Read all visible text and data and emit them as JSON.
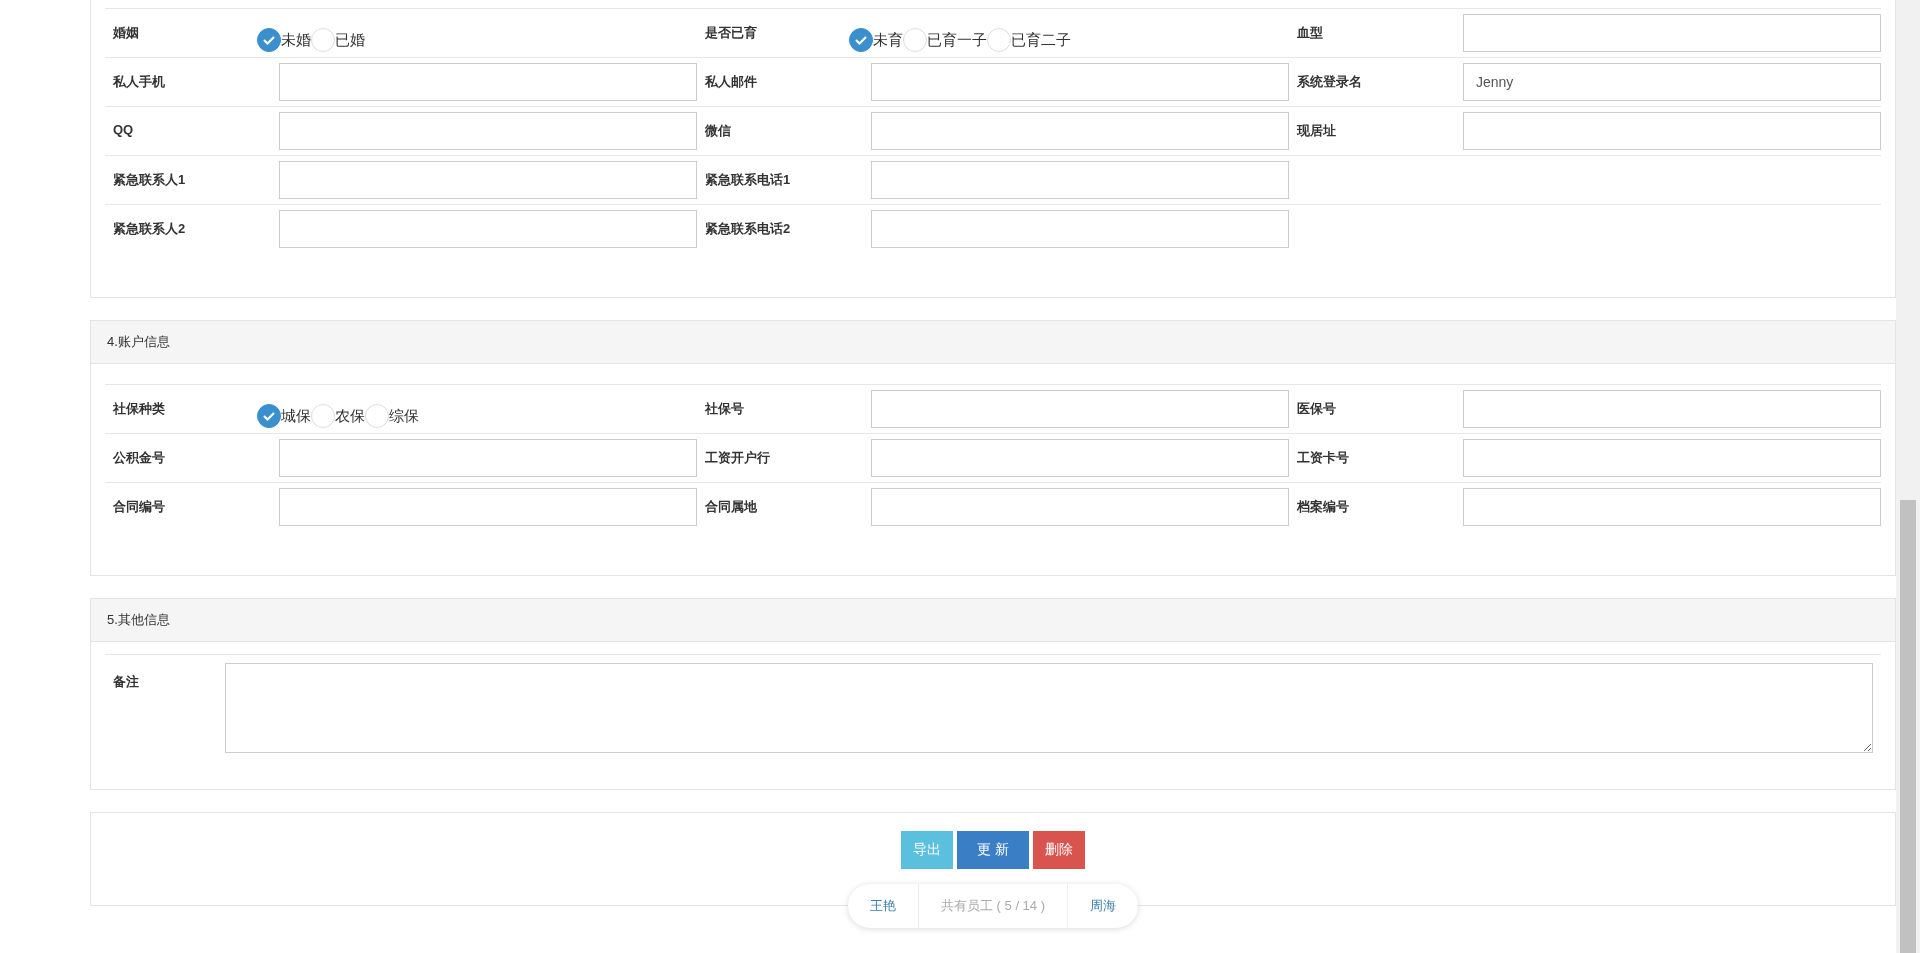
{
  "sections": [
    {
      "rows": [
        [
          {
            "label": "婚姻",
            "kind": "radio",
            "options": [
              {
                "label": "未婚",
                "selected": true
              },
              {
                "label": "已婚",
                "selected": false
              }
            ]
          },
          {
            "label": "是否已育",
            "kind": "radio",
            "options": [
              {
                "label": "未育",
                "selected": true
              },
              {
                "label": "已育一子",
                "selected": false
              },
              {
                "label": "已育二子",
                "selected": false
              }
            ]
          },
          {
            "label": "血型",
            "kind": "text"
          }
        ],
        [
          {
            "label": "私人手机",
            "kind": "text"
          },
          {
            "label": "私人邮件",
            "kind": "text"
          },
          {
            "label": "系统登录名",
            "kind": "text",
            "value": "Jenny"
          }
        ],
        [
          {
            "label": "QQ",
            "kind": "text"
          },
          {
            "label": "微信",
            "kind": "text"
          },
          {
            "label": "现居址",
            "kind": "text"
          }
        ],
        [
          {
            "label": "紧急联系人1",
            "kind": "text"
          },
          {
            "label": "紧急联系电话1",
            "kind": "text"
          }
        ],
        [
          {
            "label": "紧急联系人2",
            "kind": "text"
          },
          {
            "label": "紧急联系电话2",
            "kind": "text"
          }
        ]
      ]
    },
    {
      "title": "4.账户信息",
      "rows": [
        [
          {
            "label": "社保种类",
            "kind": "radio",
            "options": [
              {
                "label": "城保",
                "selected": true
              },
              {
                "label": "农保",
                "selected": false
              },
              {
                "label": "综保",
                "selected": false
              }
            ]
          },
          {
            "label": "社保号",
            "kind": "text"
          },
          {
            "label": "医保号",
            "kind": "text"
          }
        ],
        [
          {
            "label": "公积金号",
            "kind": "text"
          },
          {
            "label": "工资开户行",
            "kind": "text"
          },
          {
            "label": "工资卡号",
            "kind": "text"
          }
        ],
        [
          {
            "label": "合同编号",
            "kind": "text"
          },
          {
            "label": "合同属地",
            "kind": "text"
          },
          {
            "label": "档案编号",
            "kind": "text"
          }
        ]
      ]
    },
    {
      "title": "5.其他信息",
      "remark": {
        "label": "备注"
      }
    }
  ],
  "buttons": [
    {
      "label": "导出",
      "kind": "info"
    },
    {
      "label": "更 新",
      "kind": "primary"
    },
    {
      "label": "删除",
      "kind": "danger"
    }
  ],
  "pager": {
    "prev": "王艳",
    "count": "共有员工 ( 5 / 14 )",
    "next": "周海"
  }
}
